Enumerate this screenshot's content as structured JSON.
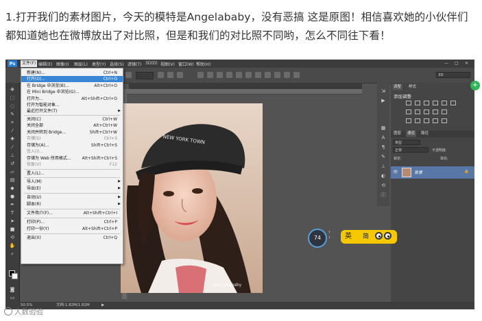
{
  "intro": {
    "line1": "1.打开我们的素材图片，今天的模特是Angelababy，没有恶搞 这是原图！相信喜欢她的小伙伴们",
    "line2": "都知道她也在微博放出了对比照，但是和我们的对比照不同哟，怎么不同往下看！"
  },
  "app": {
    "logo": "Ps",
    "menubar": [
      "文件(F)",
      "编辑(E)",
      "图像(I)",
      "图层(L)",
      "类型(Y)",
      "选择(S)",
      "滤镜(T)",
      "3D(D)",
      "视图(V)",
      "窗口(W)",
      "帮助(H)"
    ],
    "workspace": "3D"
  },
  "file_menu": {
    "items": [
      {
        "label": "新建(N)...",
        "shortcut": "Ctrl+N",
        "state": "normal"
      },
      {
        "label": "打开(O)...",
        "shortcut": "Ctrl+O",
        "state": "highlight"
      },
      {
        "label": "在 Bridge 中浏览(B)...",
        "shortcut": "Alt+Ctrl+O",
        "state": "normal"
      },
      {
        "label": "在 Mini Bridge 中浏览(G)...",
        "shortcut": "",
        "state": "normal"
      },
      {
        "label": "打开为...",
        "shortcut": "Alt+Shift+Ctrl+O",
        "state": "normal"
      },
      {
        "label": "打开为智能对象...",
        "shortcut": "",
        "state": "normal"
      },
      {
        "label": "最近打开文件(T)",
        "shortcut": "",
        "state": "submenu"
      },
      {
        "label": "关闭(C)",
        "shortcut": "Ctrl+W",
        "state": "normal"
      },
      {
        "label": "关闭全部",
        "shortcut": "Alt+Ctrl+W",
        "state": "normal"
      },
      {
        "label": "关闭并转到 Bridge...",
        "shortcut": "Shift+Ctrl+W",
        "state": "normal"
      },
      {
        "label": "存储(S)",
        "shortcut": "Ctrl+S",
        "state": "disabled"
      },
      {
        "label": "存储为(A)...",
        "shortcut": "Shift+Ctrl+S",
        "state": "normal"
      },
      {
        "label": "签入(I)...",
        "shortcut": "",
        "state": "disabled"
      },
      {
        "label": "存储为 Web 所用格式...",
        "shortcut": "Alt+Shift+Ctrl+S",
        "state": "normal"
      },
      {
        "label": "恢复(V)",
        "shortcut": "F12",
        "state": "disabled"
      },
      {
        "label": "置入(L)...",
        "shortcut": "",
        "state": "normal"
      },
      {
        "label": "导入(M)",
        "shortcut": "",
        "state": "submenu"
      },
      {
        "label": "导出(E)",
        "shortcut": "",
        "state": "submenu"
      },
      {
        "label": "自动(U)",
        "shortcut": "",
        "state": "submenu"
      },
      {
        "label": "脚本(R)",
        "shortcut": "",
        "state": "submenu"
      },
      {
        "label": "文件简介(F)...",
        "shortcut": "Alt+Shift+Ctrl+I",
        "state": "normal"
      },
      {
        "label": "打印(P)...",
        "shortcut": "Ctrl+P",
        "state": "normal"
      },
      {
        "label": "打印一份(Y)",
        "shortcut": "Alt+Shift+Ctrl+P",
        "state": "normal"
      },
      {
        "label": "退出(X)",
        "shortcut": "Ctrl+Q",
        "state": "normal"
      }
    ]
  },
  "adjust_panel": {
    "tabs": [
      "调整",
      "样式"
    ],
    "title": "添加调整"
  },
  "layers_panel": {
    "tabs": [
      "图层",
      "通道",
      "路径"
    ],
    "kind": "类型",
    "blend": "正常",
    "opacity_label": "不透明度:",
    "fill_label": "填充:",
    "lock_label": "锁定:",
    "layer_name": "背景"
  },
  "photo": {
    "watermark": "@angelababy",
    "cap_text": "NEW YORK TOWN"
  },
  "status": {
    "zoom": "50.5%",
    "doc": "文档:1.82M/1.82M"
  },
  "overlay": {
    "percent": "74",
    "net_up": "↑",
    "net_down": "↓",
    "ime_left": "英",
    "ime_mid": "简"
  },
  "site_watermark": "人数验验"
}
